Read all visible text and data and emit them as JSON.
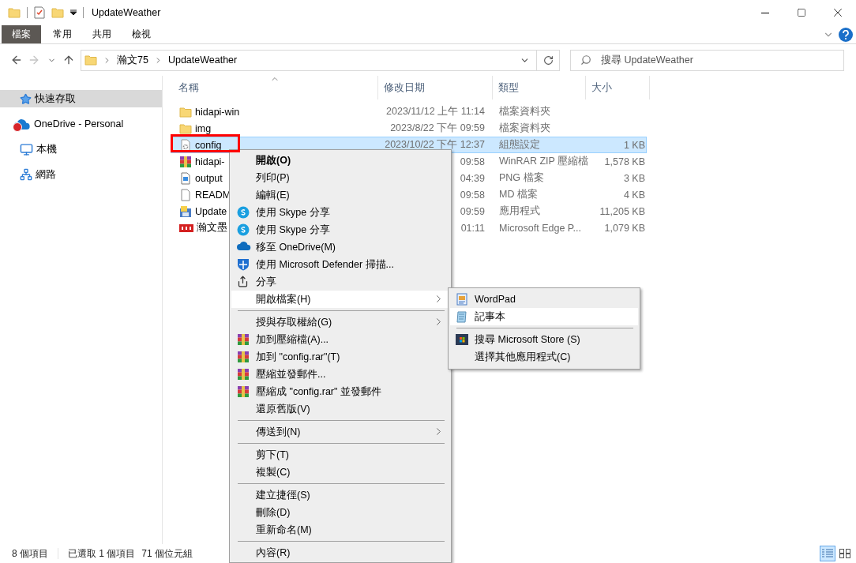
{
  "window": {
    "title": "UpdateWeather"
  },
  "ribbon": {
    "tabs": [
      {
        "label": "檔案",
        "kind": "file"
      },
      {
        "label": "常用",
        "kind": "tab"
      },
      {
        "label": "共用",
        "kind": "tab"
      },
      {
        "label": "檢視",
        "kind": "tab"
      }
    ]
  },
  "navigation": [
    {
      "kind": "back",
      "disabled": false
    },
    {
      "kind": "forward",
      "disabled": true
    },
    {
      "kind": "recent",
      "disabled": false
    },
    {
      "kind": "up",
      "disabled": false
    }
  ],
  "address": {
    "path": [
      "瀚文75",
      "UpdateWeather"
    ]
  },
  "search": {
    "placeholder": "搜尋 UpdateWeather"
  },
  "sidebar": {
    "items": [
      {
        "label": "快速存取",
        "kind": "quick-access",
        "selected": true,
        "error": false
      },
      {
        "label": "OneDrive - Personal",
        "kind": "cloud",
        "selected": false,
        "error": true
      },
      {
        "label": "本機",
        "kind": "computer",
        "selected": false,
        "error": false
      },
      {
        "label": "網路",
        "kind": "network",
        "selected": false,
        "error": false
      }
    ]
  },
  "file_list": {
    "columns": [
      {
        "label": "名稱",
        "sorted": true
      },
      {
        "label": "修改日期",
        "sorted": false
      },
      {
        "label": "類型",
        "sorted": false
      },
      {
        "label": "大小",
        "sorted": false
      }
    ],
    "rows": [
      {
        "kind": "folder",
        "name": "hidapi-win",
        "modified": "2023/11/12 上午 11:14",
        "type": "檔案資料夾",
        "selected": false,
        "marked": false
      },
      {
        "kind": "folder",
        "name": "img",
        "modified": "2023/8/22 下午 09:59",
        "type": "檔案資料夾",
        "selected": false,
        "marked": false
      },
      {
        "kind": "config",
        "name": "config",
        "modified": "2023/10/22 下午 12:37",
        "type": "組態設定",
        "size": "1 KB",
        "selected": true,
        "marked": true
      },
      {
        "kind": "archive",
        "name": "hidapi-",
        "modified": "09:58",
        "type": "WinRAR ZIP 壓縮檔",
        "size": "1,578 KB",
        "selected": false,
        "marked": false
      },
      {
        "kind": "image",
        "name": "output",
        "modified": "04:39",
        "type": "PNG 檔案",
        "size": "3 KB",
        "selected": false,
        "marked": false
      },
      {
        "kind": "text",
        "name": "READM",
        "modified": "09:58",
        "type": "MD 檔案",
        "size": "4 KB",
        "selected": false,
        "marked": false
      },
      {
        "kind": "app",
        "name": "Update",
        "modified": "09:59",
        "type": "應用程式",
        "size": "11,205 KB",
        "selected": false,
        "marked": false
      },
      {
        "kind": "pdf",
        "name": "瀚文墨",
        "modified": "01:11",
        "type": "Microsoft Edge P...",
        "size": "1,079 KB",
        "selected": false,
        "marked": false
      }
    ]
  },
  "context_menu": {
    "items": [
      {
        "kind": "plain",
        "label": "開啟(O)",
        "default": true,
        "submenu": false,
        "highlighted": false
      },
      {
        "kind": "plain",
        "label": "列印(P)",
        "default": false,
        "submenu": false,
        "highlighted": false
      },
      {
        "kind": "plain",
        "label": "編輯(E)",
        "default": false,
        "submenu": false,
        "highlighted": false
      },
      {
        "kind": "skype",
        "label": "使用 Skype 分享",
        "default": false,
        "submenu": false,
        "highlighted": false
      },
      {
        "kind": "skype",
        "label": "使用 Skype 分享",
        "default": false,
        "submenu": false,
        "highlighted": false
      },
      {
        "kind": "cloud",
        "label": "移至 OneDrive(M)",
        "default": false,
        "submenu": false,
        "highlighted": false
      },
      {
        "kind": "shield",
        "label": "使用 Microsoft Defender 掃描...",
        "default": false,
        "submenu": false,
        "highlighted": false
      },
      {
        "kind": "share",
        "label": "分享",
        "default": false,
        "submenu": false,
        "highlighted": false
      },
      {
        "kind": "plain",
        "label": "開啟檔案(H)",
        "default": false,
        "submenu": true,
        "highlighted": true
      },
      {
        "kind": "separator"
      },
      {
        "kind": "plain",
        "label": "授與存取權給(G)",
        "default": false,
        "submenu": true,
        "highlighted": false
      },
      {
        "kind": "archive",
        "label": "加到壓縮檔(A)...",
        "default": false,
        "submenu": false,
        "highlighted": false
      },
      {
        "kind": "archive",
        "label": "加到 \"config.rar\"(T)",
        "default": false,
        "submenu": false,
        "highlighted": false
      },
      {
        "kind": "archive",
        "label": "壓縮並發郵件...",
        "default": false,
        "submenu": false,
        "highlighted": false
      },
      {
        "kind": "archive",
        "label": "壓縮成 \"config.rar\" 並發郵件",
        "default": false,
        "submenu": false,
        "highlighted": false
      },
      {
        "kind": "plain",
        "label": "還原舊版(V)",
        "default": false,
        "submenu": false,
        "highlighted": false
      },
      {
        "kind": "separator"
      },
      {
        "kind": "plain",
        "label": "傳送到(N)",
        "default": false,
        "submenu": true,
        "highlighted": false
      },
      {
        "kind": "separator"
      },
      {
        "kind": "plain",
        "label": "剪下(T)",
        "default": false,
        "submenu": false,
        "highlighted": false
      },
      {
        "kind": "plain",
        "label": "複製(C)",
        "default": false,
        "submenu": false,
        "highlighted": false
      },
      {
        "kind": "separator"
      },
      {
        "kind": "plain",
        "label": "建立捷徑(S)",
        "default": false,
        "submenu": false,
        "highlighted": false
      },
      {
        "kind": "plain",
        "label": "刪除(D)",
        "default": false,
        "submenu": false,
        "highlighted": false
      },
      {
        "kind": "plain",
        "label": "重新命名(M)",
        "default": false,
        "submenu": false,
        "highlighted": false
      },
      {
        "kind": "separator"
      },
      {
        "kind": "plain",
        "label": "內容(R)",
        "default": false,
        "submenu": false,
        "highlighted": false
      }
    ]
  },
  "open_with_menu": {
    "items": [
      {
        "kind": "wordpad",
        "label": "WordPad",
        "highlighted": false
      },
      {
        "kind": "notepad",
        "label": "記事本",
        "highlighted": true
      },
      {
        "kind": "separator"
      },
      {
        "kind": "store",
        "label": "搜尋 Microsoft Store (S)",
        "highlighted": false
      },
      {
        "kind": "plain",
        "label": "選擇其他應用程式(C)",
        "highlighted": false
      }
    ]
  },
  "status_bar": {
    "item_count": "8 個項目",
    "selection": "已選取 1 個項目",
    "size": "71 個位元組",
    "view_buttons": [
      {
        "kind": "details",
        "selected": true
      },
      {
        "kind": "large-icons",
        "selected": false
      }
    ]
  }
}
